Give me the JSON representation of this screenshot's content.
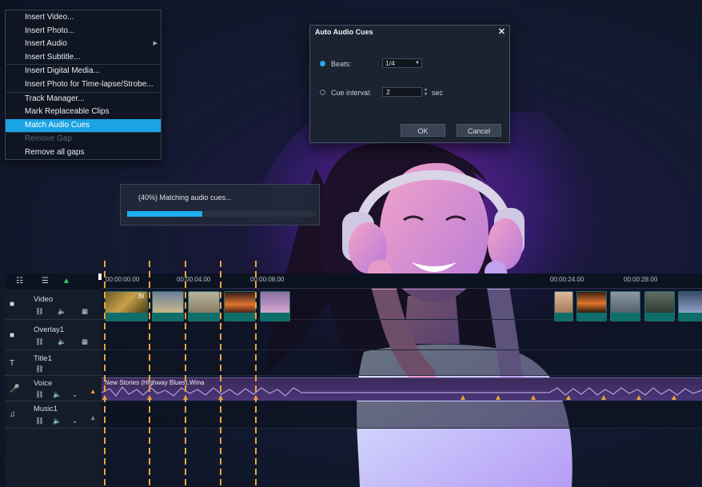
{
  "context_menu": {
    "items": [
      {
        "label": "Insert Video...",
        "state": "normal"
      },
      {
        "label": "Insert Photo...",
        "state": "normal"
      },
      {
        "label": "Insert Audio",
        "state": "normal",
        "submenu": true
      },
      {
        "label": "Insert Subtitle...",
        "state": "normal"
      },
      {
        "label": "Insert Digital Media...",
        "state": "normal"
      },
      {
        "label": "Insert Photo for Time-lapse/Strobe...",
        "state": "normal"
      },
      {
        "label": "Track Manager...",
        "state": "normal"
      },
      {
        "label": "Mark Replaceable Clips",
        "state": "normal"
      },
      {
        "label": "Match Audio Cues",
        "state": "active"
      },
      {
        "label": "Remove Gap",
        "state": "disabled"
      },
      {
        "label": "Remove all gaps",
        "state": "normal"
      }
    ]
  },
  "dialog": {
    "title": "Auto Audio Cues",
    "close_icon": "close-icon",
    "beats_label": "Beats:",
    "beats_value": "1/4",
    "cue_interval_label": "Cue interval:",
    "cue_interval_value": "2",
    "cue_interval_unit": "sec",
    "ok_label": "OK",
    "cancel_label": "Cancel",
    "selected_option": "beats"
  },
  "progress": {
    "text": "(40%) Matching audio cues...",
    "value": 0.4
  },
  "timeline": {
    "toolbar_icons": [
      "track-list-icon",
      "settings-list-icon",
      "cue-marker-icon"
    ],
    "ruler_labels": [
      "00:00:00.00",
      "00:00:04.00",
      "00:00:08.00",
      "00:00:24.00",
      "00:00:28.00"
    ],
    "tracks": [
      {
        "name": "Video",
        "icon": "video-track-icon"
      },
      {
        "name": "Overlay1",
        "icon": "overlay-track-icon"
      },
      {
        "name": "Title1",
        "icon": "title-track-icon"
      },
      {
        "name": "Voice",
        "icon": "voice-track-icon"
      },
      {
        "name": "Music1",
        "icon": "music-track-icon"
      }
    ],
    "first_clip_label": "Bl",
    "voice_clip_label": "New Stories (Highway Blues).Wma"
  },
  "colors": {
    "accent": "#1aa3e3",
    "cue_line": "#e9a43a",
    "voice_clip": "#4b3578",
    "clip_footer": "#0f6e6a"
  }
}
